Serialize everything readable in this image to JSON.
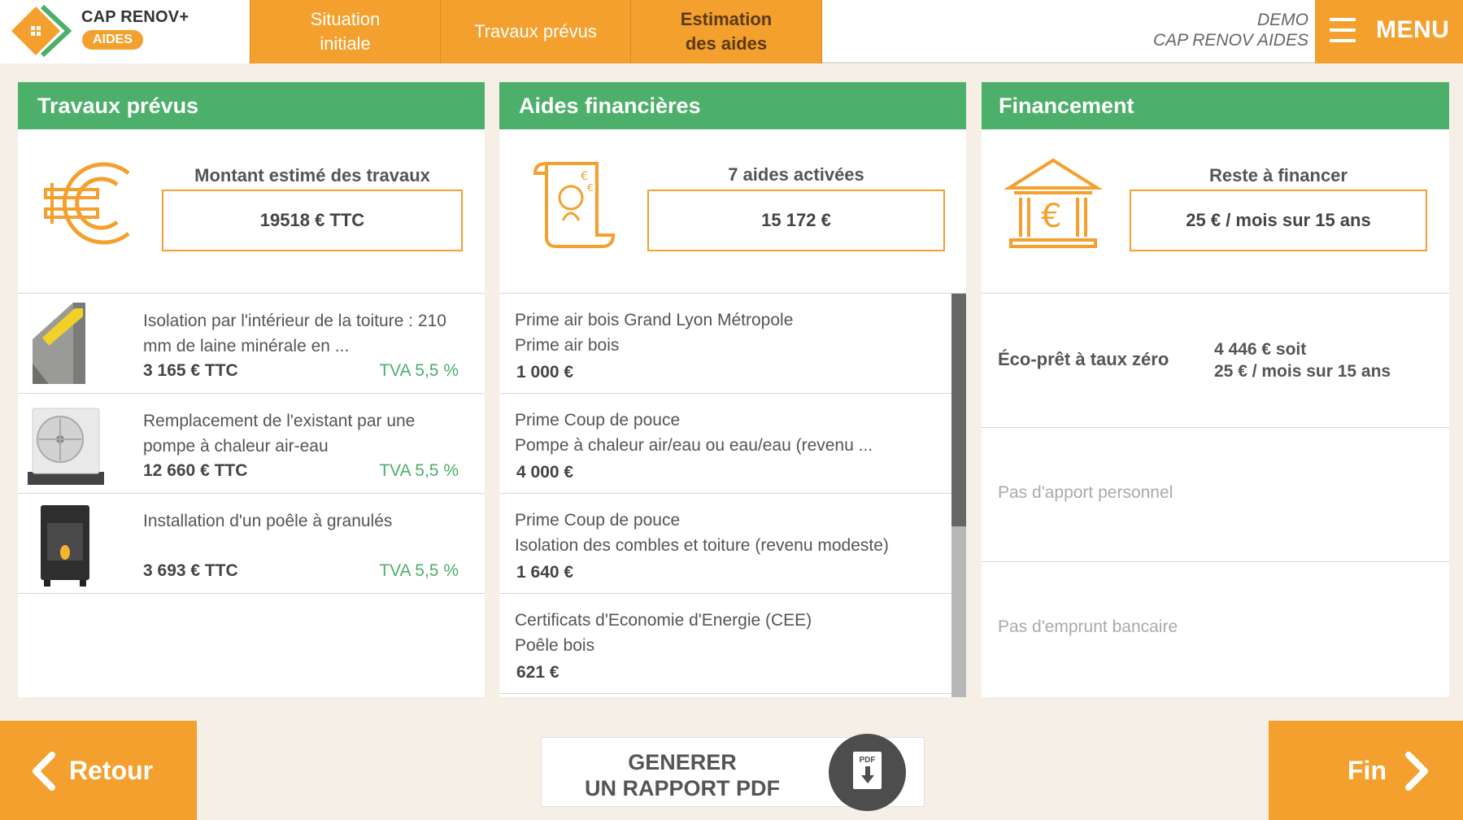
{
  "header": {
    "logo_title": "CAP RENOV+",
    "logo_badge": "AIDES",
    "tabs": [
      {
        "label": "Situation\ninitiale",
        "active": false
      },
      {
        "label": "Travaux prévus",
        "active": false
      },
      {
        "label": "Estimation\ndes aides",
        "active": true
      }
    ],
    "user_line1": "DEMO",
    "user_line2": "CAP RENOV AIDES",
    "menu_label": "MENU"
  },
  "travaux": {
    "title": "Travaux prévus",
    "summary_label": "Montant estimé des travaux",
    "summary_value": "19518 € TTC",
    "items": [
      {
        "title": "Isolation par l'intérieur de la toiture : 210 mm de laine minérale en ...",
        "price": "3 165 € TTC",
        "tva": "TVA 5,5 %",
        "icon": "roof-insulation-icon"
      },
      {
        "title": "Remplacement de l'existant par une pompe à chaleur air-eau",
        "price": "12 660 € TTC",
        "tva": "TVA 5,5 %",
        "icon": "heat-pump-icon"
      },
      {
        "title": "Installation d'un poêle à granulés",
        "price": "3 693 € TTC",
        "tva": "TVA 5,5 %",
        "icon": "pellet-stove-icon"
      }
    ]
  },
  "aides": {
    "title": "Aides financières",
    "summary_label": "7 aides activées",
    "summary_value": "15 172 €",
    "items": [
      {
        "line1": "Prime air bois Grand Lyon Métropole",
        "line2": "Prime air bois",
        "amount": "1 000 €"
      },
      {
        "line1": "Prime Coup de pouce",
        "line2": "Pompe à chaleur air/eau ou eau/eau (revenu ...",
        "amount": "4 000 €"
      },
      {
        "line1": "Prime Coup de pouce",
        "line2": "Isolation des combles et toiture (revenu modeste)",
        "amount": "1 640 €"
      },
      {
        "line1": "Certificats d'Economie d'Energie (CEE)",
        "line2": "Poêle bois",
        "amount": "621 €"
      }
    ]
  },
  "financement": {
    "title": "Financement",
    "summary_label": "Reste à financer",
    "summary_value": "25 € / mois sur 15 ans",
    "eco_pret_label": "Éco-prêt à taux zéro",
    "eco_pret_line1": "4 446 € soit",
    "eco_pret_line2": "25 € / mois sur 15 ans",
    "apport": "Pas d'apport personnel",
    "emprunt": "Pas d'emprunt bancaire"
  },
  "footer": {
    "back_label": "Retour",
    "pdf_line1": "GENERER",
    "pdf_line2": "UN RAPPORT PDF",
    "pdf_icon_label": "PDF",
    "next_label": "Fin"
  },
  "colors": {
    "accent_orange": "#f4a02e",
    "accent_green": "#4caf6a",
    "background": "#f5efe6"
  }
}
